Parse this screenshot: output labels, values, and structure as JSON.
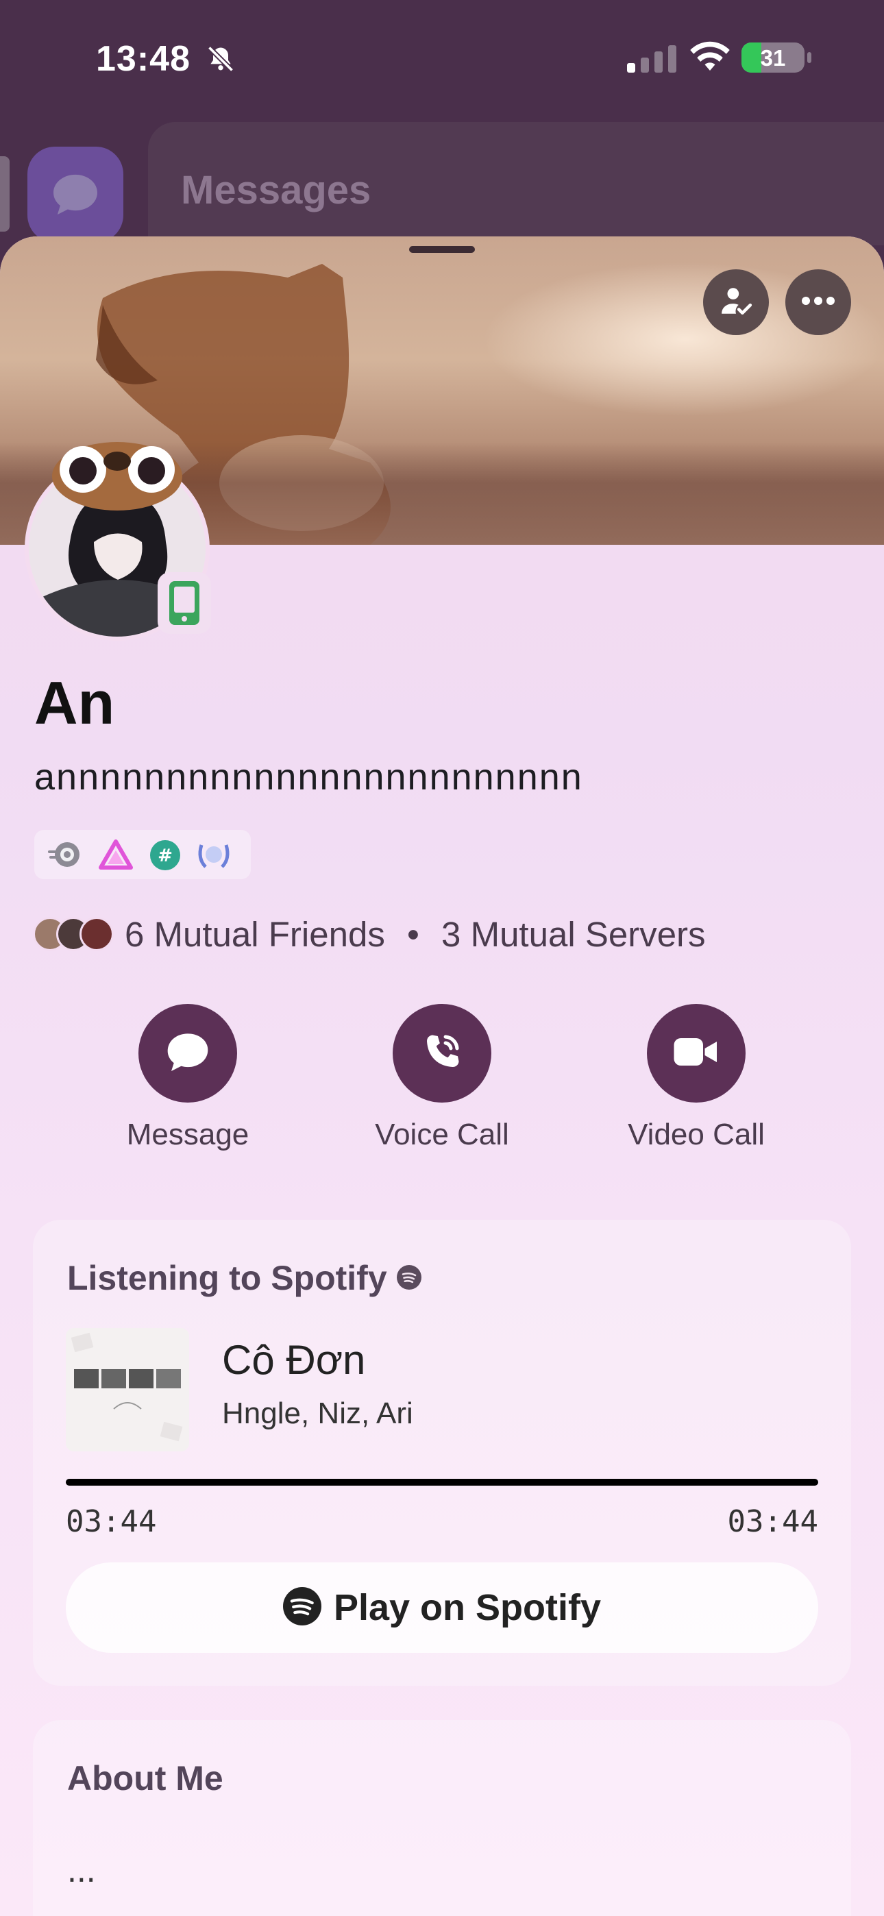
{
  "status_bar": {
    "time": "13:48",
    "battery": "31"
  },
  "background": {
    "title": "Messages"
  },
  "profile": {
    "display_name": "An",
    "username": "annnnnnnnnnnnnnnnnnnnnnnn",
    "badge_icons": [
      "nitro-badge-icon",
      "triangle-badge-icon",
      "hashtag-badge-icon",
      "laurel-badge-icon"
    ],
    "mutual_friends": "6 Mutual Friends",
    "separator": "•",
    "mutual_servers": "3 Mutual Servers"
  },
  "actions": {
    "message": "Message",
    "voice_call": "Voice Call",
    "video_call": "Video Call"
  },
  "activity": {
    "title": "Listening to Spotify",
    "song": "Cô Đơn",
    "artists": "Hngle, Niz, Ari",
    "elapsed": "03:44",
    "duration": "03:44",
    "progress": 1.0,
    "button": "Play on Spotify"
  },
  "about": {
    "title": "About Me",
    "text": "..."
  },
  "colors": {
    "accent": "#5c3056",
    "sheet_bg": "#f3dcf1",
    "spotify": "#1db954",
    "status_mobile": "#3ba55c"
  }
}
